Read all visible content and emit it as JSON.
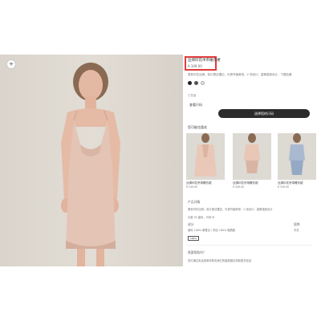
{
  "product": {
    "title": "丝绸印花吊带睡衣裙",
    "price": "¥ 349.00",
    "description": "柔软印花丝绸，前片蕾丝镶边，可调节细肩带，V 领设计，直筒裙身设计，下摆及膝",
    "sold_out_text": "已售罄",
    "size_guide_label": "查看尺码",
    "add_to_bag_label": "选择您的尺码",
    "swatches": [
      "#222222",
      "#555555",
      "#e7e5e3"
    ]
  },
  "recommend": {
    "title": "您可能也喜欢",
    "items": [
      {
        "name": "丝绸印花吊带睡衣裙",
        "price": "¥ 349.00"
      },
      {
        "name": "丝绸印花吊带睡衣裙",
        "price": "¥ 349.00"
      },
      {
        "name": "丝绸印花吊带睡衣裙",
        "price": "¥ 349.00"
      }
    ]
  },
  "details": {
    "heading": "产品详情",
    "line1": "柔软印花丝绸，前片蕾丝镶边，可调节细肩带，V 领设计，直筒裙身设计",
    "line2": "长度 95 厘米，尺码 M",
    "composition_label": "成分",
    "care_label": "保养",
    "composition": "面料 100% 桑蚕丝 / 饰边 100% 聚酰胺",
    "care": "手洗",
    "tag": "100%"
  },
  "delivery": {
    "heading": "需要帮助吗？",
    "text": "您可通过电话或邮件联系我们的客服团队获取更多信息"
  }
}
